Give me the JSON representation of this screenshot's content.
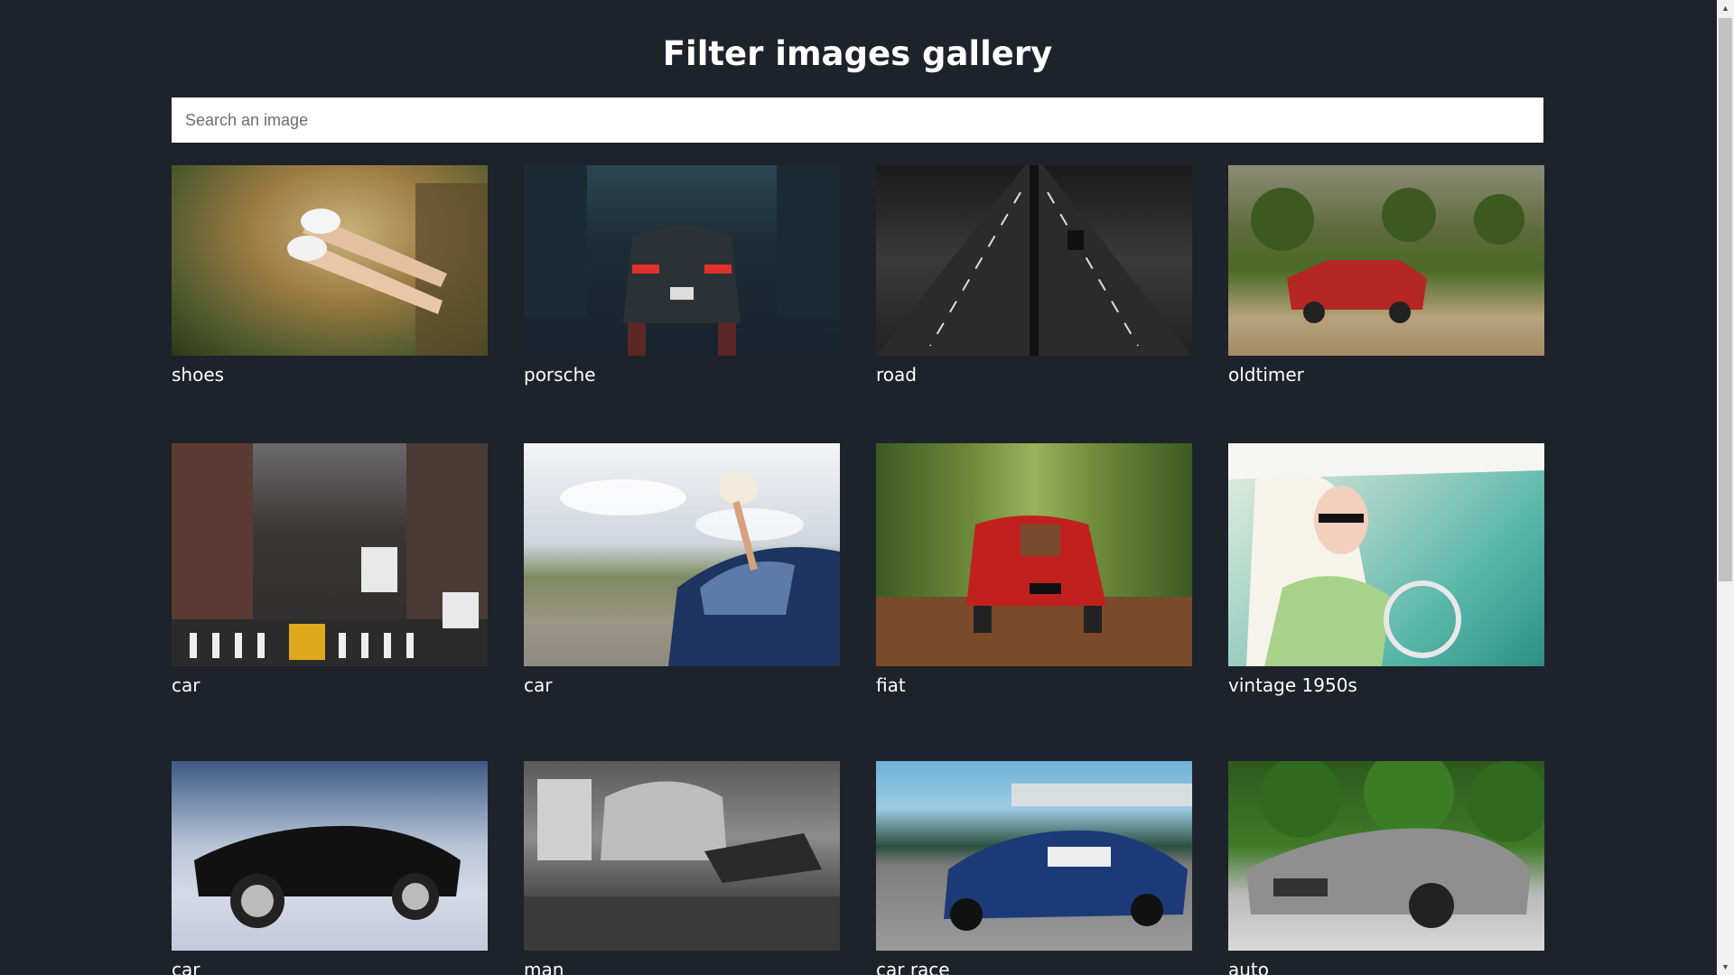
{
  "header": {
    "title": "Filter images gallery"
  },
  "search": {
    "placeholder": "Search an image",
    "value": ""
  },
  "gallery": {
    "items": [
      {
        "label": "shoes"
      },
      {
        "label": "porsche"
      },
      {
        "label": "road"
      },
      {
        "label": "oldtimer"
      },
      {
        "label": "car"
      },
      {
        "label": "car"
      },
      {
        "label": "fiat"
      },
      {
        "label": "vintage 1950s"
      },
      {
        "label": "car"
      },
      {
        "label": "man"
      },
      {
        "label": "car race"
      },
      {
        "label": "auto"
      }
    ]
  },
  "colors": {
    "background": "#1e222a",
    "text": "#ffffff",
    "search_bg": "#ffffff"
  }
}
